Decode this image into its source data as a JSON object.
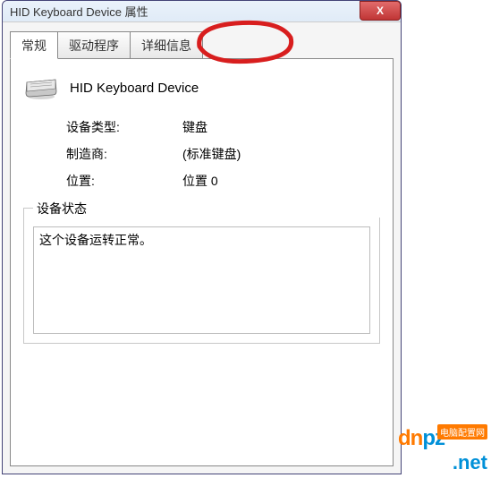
{
  "window": {
    "title": "HID Keyboard Device 属性",
    "close_x": "X"
  },
  "tabs": [
    {
      "label": "常规"
    },
    {
      "label": "驱动程序"
    },
    {
      "label": "详细信息"
    }
  ],
  "device": {
    "icon": "keyboard-icon",
    "name": "HID Keyboard Device"
  },
  "props": {
    "type_label": "设备类型:",
    "type_value": "键盘",
    "mfr_label": "制造商:",
    "mfr_value": "(标准键盘)",
    "loc_label": "位置:",
    "loc_value": "位置 0"
  },
  "status": {
    "legend": "设备状态",
    "text": "这个设备运转正常。"
  },
  "watermark": {
    "dn": "dn",
    "pz": "pz",
    "net": ".net",
    "tag": "电脑配置网"
  }
}
